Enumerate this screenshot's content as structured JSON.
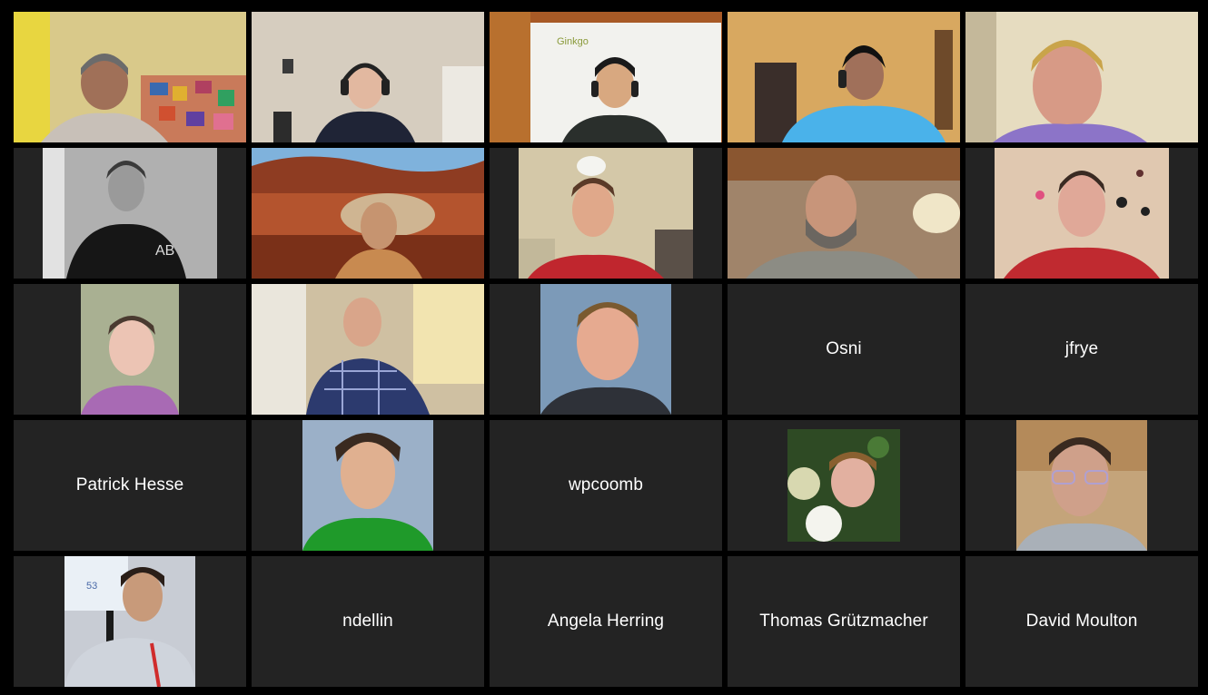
{
  "meeting": {
    "participants": [
      {
        "name": "",
        "video": true
      },
      {
        "name": "",
        "video": true
      },
      {
        "name": "",
        "video": true,
        "wall_logo": "Ginkgo"
      },
      {
        "name": "",
        "video": true
      },
      {
        "name": "",
        "video": true
      },
      {
        "name": "",
        "video": true,
        "shirt_text": "AB"
      },
      {
        "name": "",
        "video": true
      },
      {
        "name": "",
        "video": true
      },
      {
        "name": "",
        "video": true
      },
      {
        "name": "",
        "video": true
      },
      {
        "name": "",
        "video": true
      },
      {
        "name": "",
        "video": true
      },
      {
        "name": "",
        "video": true
      },
      {
        "name": "Osni",
        "video": false
      },
      {
        "name": "jfrye",
        "video": false
      },
      {
        "name": "Patrick Hesse",
        "video": false
      },
      {
        "name": "",
        "video": true
      },
      {
        "name": "wpcoomb",
        "video": false
      },
      {
        "name": "",
        "video": true
      },
      {
        "name": "",
        "video": true
      },
      {
        "name": "",
        "video": true,
        "slide_number": "53"
      },
      {
        "name": "ndellin",
        "video": false
      },
      {
        "name": "Angela Herring",
        "video": false
      },
      {
        "name": "Thomas Grützmacher",
        "video": false
      },
      {
        "name": "David Moulton",
        "video": false
      }
    ]
  },
  "colors": {
    "tile_background": "#232323",
    "gallery_background": "#000000",
    "name_text": "#ffffff"
  }
}
